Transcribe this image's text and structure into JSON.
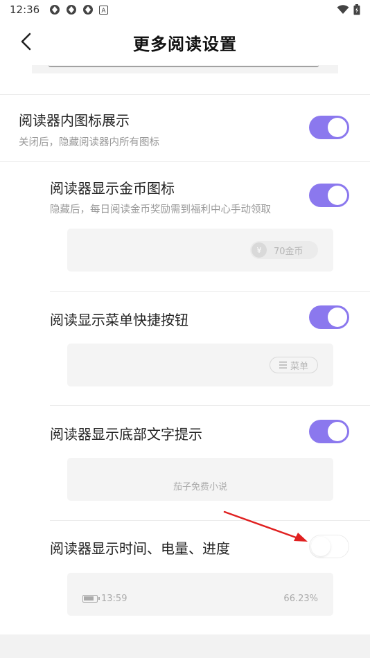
{
  "status_bar": {
    "time": "12:36",
    "icons": [
      "sync-icon",
      "sync-icon",
      "sync-icon",
      "a-icon"
    ],
    "right_icons": [
      "wifi-icon",
      "battery-icon"
    ]
  },
  "header": {
    "back_icon": "chevron-left-icon",
    "title": "更多阅读设置"
  },
  "settings": [
    {
      "title": "阅读器内图标展示",
      "subtitle": "关闭后，隐藏阅读器内所有图标",
      "enabled": true
    },
    {
      "title": "阅读器显示金币图标",
      "subtitle": "隐藏后，每日阅读金币奖励需到福利中心手动领取",
      "enabled": true,
      "preview": {
        "coin_symbol": "¥",
        "coin_text": "70金币"
      }
    },
    {
      "title": "阅读显示菜单快捷按钮",
      "enabled": true,
      "preview": {
        "menu_icon": "menu-lines-icon",
        "menu_text": "菜单"
      }
    },
    {
      "title": "阅读器显示底部文字提示",
      "enabled": true,
      "preview": {
        "caption": "茄子免费小说"
      }
    },
    {
      "title": "阅读器显示时间、电量、进度",
      "enabled": false,
      "preview": {
        "time": "13:59",
        "progress": "66.23%"
      }
    }
  ],
  "colors": {
    "toggle_on": "#8b78ee",
    "toggle_off_border": "#ececec",
    "annotation_arrow": "#e02020"
  }
}
